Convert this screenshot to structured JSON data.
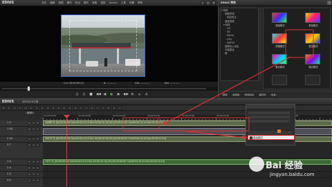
{
  "preview": {
    "app_name": "EDIUS",
    "menu": [
      "文件",
      "编辑",
      "视图",
      "素材",
      "标记",
      "模式",
      "采集",
      "渲染",
      "Ascore",
      "工具",
      "设置",
      "帮助"
    ],
    "timecode_current": "Cur 00:00:00:12",
    "timecode_in": "In --:--:--:--",
    "timecode_out": "Out --:--:--:--",
    "timecode_dur": "Dur --:--:--:--"
  },
  "effects": {
    "title": "EDIUS 特效",
    "tree": [
      "特效",
      "视频滤镜",
      "色彩校正",
      "音频滤镜",
      "转场",
      "2D",
      "3D",
      "Alpha",
      "GPU",
      "SMPTE",
      "音频淡入淡出",
      "字幕混合",
      "键"
    ],
    "cells": [
      {
        "label": "相加模式"
      },
      {
        "label": "叠加模式"
      },
      {
        "label": "变暗模式"
      },
      {
        "label": "叠加模式"
      },
      {
        "label": "柔光模式"
      },
      {
        "label": "强光模式"
      }
    ],
    "tabs": [
      "特效",
      "素材库",
      "序列标记",
      "源文件",
      "信息"
    ]
  },
  "timeline": {
    "app_name": "EDIUS",
    "project": "3820416工程",
    "sequence_tab": "序列1",
    "ruler_labels": [
      "00:00:00:00",
      "00:00:05:00",
      "00:00:10:00",
      "00:00:15:00",
      "00:00:20:00",
      "00:00:25:00",
      "00:00:30:00",
      "00:00:35:00"
    ],
    "tracks": [
      {
        "name": "1 V",
        "clip": "10468  TL [00:00:00:00 Out:00:00:10:10 Dur:00:00:10:10]  Sh:[00:00:00:00 Out:00:00:10:10 Dur:00:00:10:10]"
      },
      {
        "name": "1 VA",
        "clip": ""
      },
      {
        "name": "2 VA",
        "clip": "10473  TL [00:00:00:00 Out:00:00:10:10 Dur:00:00:10:10]  Sh:[00:00:00:00 Out:00:00:10:10 Dur:00:00:10:10]"
      },
      {
        "name": "3 T",
        "clip": ""
      },
      {
        "name": "1 A",
        "clip": "1472  TL [00:00:00:00 Out:00:00:10:10 Dur:00:00:10:10]  Sh:[00:00:00:00 Out:00:00:10:10 Dur:00:00:10:10]"
      },
      {
        "name": "2 A",
        "clip": ""
      },
      {
        "name": "3 A",
        "clip": ""
      },
      {
        "name": "4 A",
        "clip": ""
      }
    ]
  },
  "popup": {
    "item": "叠加模式"
  },
  "watermark": {
    "brand": "Bai 经验",
    "url": "jingyan.baidu.com"
  },
  "colors": {
    "annotation": "#e03030",
    "video_clip": "#5a6a4a",
    "audio_clip": "#3f6a36"
  }
}
